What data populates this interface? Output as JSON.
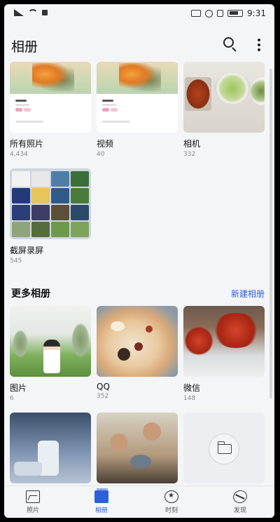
{
  "status_bar": {
    "time": "9:31"
  },
  "header": {
    "title": "相册"
  },
  "albums": [
    {
      "name": "所有照片",
      "count": "4,434"
    },
    {
      "name": "视频",
      "count": "40"
    },
    {
      "name": "相机",
      "count": "332"
    },
    {
      "name": "截屏录屏",
      "count": "545"
    }
  ],
  "more_section": {
    "title": "更多相册",
    "new_album_label": "新建相册"
  },
  "more_albums": [
    {
      "name": "图片",
      "count": "6"
    },
    {
      "name": "QQ",
      "count": "352"
    },
    {
      "name": "微信",
      "count": "148"
    }
  ],
  "bottom_nav": [
    {
      "label": "照片",
      "icon": "photo-icon"
    },
    {
      "label": "相册",
      "icon": "album-icon"
    },
    {
      "label": "时刻",
      "icon": "moments-icon"
    },
    {
      "label": "发现",
      "icon": "discover-icon"
    }
  ],
  "colors": {
    "accent": "#2f5fd8",
    "background": "#f4f5f7"
  }
}
